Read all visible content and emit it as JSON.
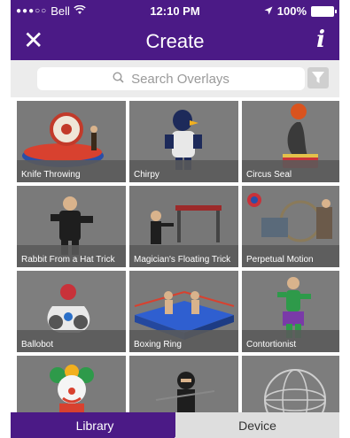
{
  "status": {
    "carrier": "Bell",
    "time": "12:10 PM",
    "battery": "100%"
  },
  "nav": {
    "title": "Create",
    "close_icon": "close-icon",
    "info_icon": "info-icon",
    "close_glyph": "✕",
    "info_glyph": "i"
  },
  "search": {
    "placeholder": "Search Overlays"
  },
  "tiles": [
    {
      "label": "Knife Throwing"
    },
    {
      "label": "Chirpy"
    },
    {
      "label": "Circus Seal"
    },
    {
      "label": "Rabbit From a Hat Trick"
    },
    {
      "label": "Magician's Floating Trick"
    },
    {
      "label": "Perpetual Motion"
    },
    {
      "label": "Ballobot"
    },
    {
      "label": "Boxing Ring"
    },
    {
      "label": "Contortionist"
    },
    {
      "label": ""
    },
    {
      "label": ""
    },
    {
      "label": ""
    }
  ],
  "tabs": {
    "library": "Library",
    "device": "Device"
  },
  "colors": {
    "brand": "#4b1a86",
    "tile_bg": "#6d6d6d"
  }
}
